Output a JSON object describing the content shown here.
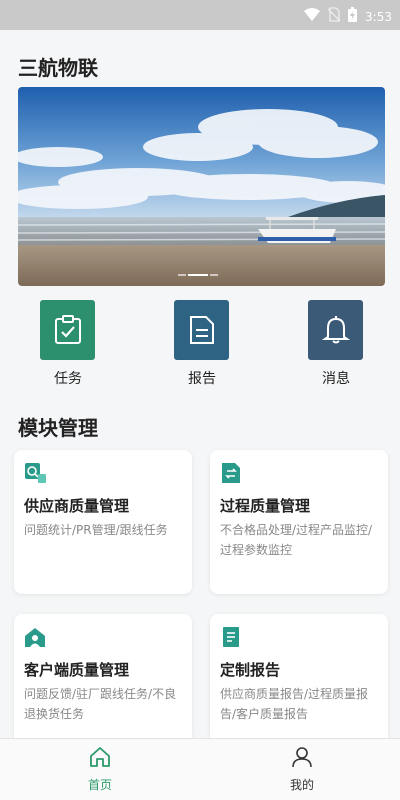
{
  "status_bar": {
    "time": "3:53",
    "icons": [
      "wifi-icon",
      "no-sim-icon",
      "battery-icon"
    ]
  },
  "app": {
    "title": "三航物联"
  },
  "banner": {
    "image": "seaside-beach-photo",
    "watermark": "",
    "active_page": 2,
    "page_count": 3
  },
  "quick_actions": [
    {
      "label": "任务",
      "icon": "task-checklist-icon",
      "color": "#2c8f6e"
    },
    {
      "label": "报告",
      "icon": "report-document-icon",
      "color": "#2e6384"
    },
    {
      "label": "消息",
      "icon": "bell-icon",
      "color": "#3a5a78"
    }
  ],
  "modules": {
    "title": "模块管理",
    "items": [
      {
        "title": "供应商质量管理",
        "desc": "问题统计/PR管理/跟线任务",
        "icon": "supplier-quality-icon"
      },
      {
        "title": "过程质量管理",
        "desc": "不合格品处理/过程产品监控/过程参数监控",
        "icon": "process-quality-icon"
      },
      {
        "title": "客户端质量管理",
        "desc": "问题反馈/驻厂跟线任务/不良退换货任务",
        "icon": "customer-quality-icon"
      },
      {
        "title": "定制报告",
        "desc": "供应商质量报告/过程质量报告/客户质量报告",
        "icon": "custom-report-icon"
      }
    ]
  },
  "tab_bar": {
    "tabs": [
      {
        "label": "首页",
        "icon": "home-icon",
        "active": true
      },
      {
        "label": "我的",
        "icon": "user-icon",
        "active": false
      }
    ]
  },
  "colors": {
    "accent": "#2c9a6a",
    "card_icon": "#2a9a8a",
    "tab_inactive": "#333333"
  }
}
